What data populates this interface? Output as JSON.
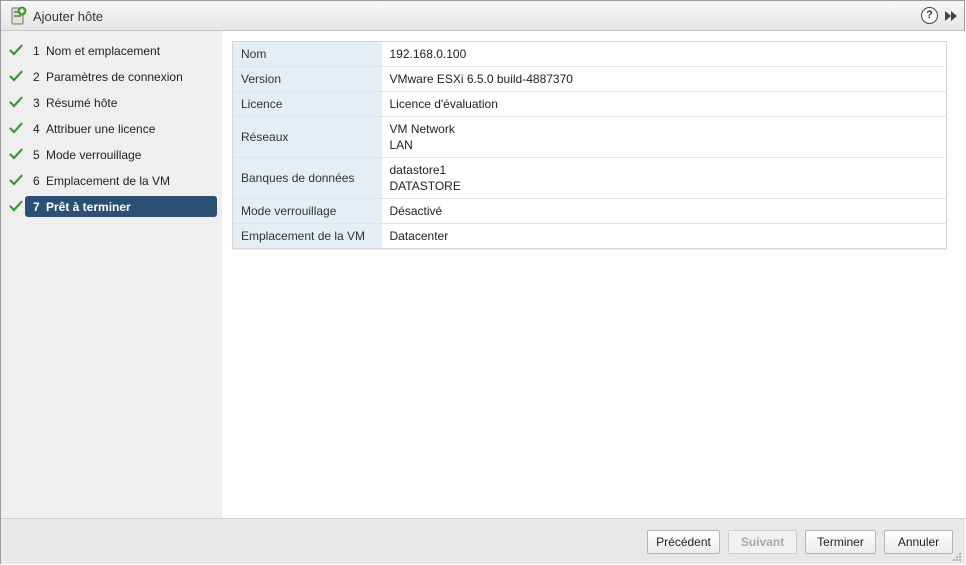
{
  "window": {
    "title": "Ajouter hôte",
    "help_label": "?"
  },
  "steps": [
    {
      "num": "1",
      "label": "Nom et emplacement",
      "completed": true,
      "active": false
    },
    {
      "num": "2",
      "label": "Paramètres de connexion",
      "completed": true,
      "active": false
    },
    {
      "num": "3",
      "label": "Résumé hôte",
      "completed": true,
      "active": false
    },
    {
      "num": "4",
      "label": "Attribuer une licence",
      "completed": true,
      "active": false
    },
    {
      "num": "5",
      "label": "Mode verrouillage",
      "completed": true,
      "active": false
    },
    {
      "num": "6",
      "label": "Emplacement de la VM",
      "completed": true,
      "active": false
    },
    {
      "num": "7",
      "label": "Prêt à terminer",
      "completed": true,
      "active": true
    }
  ],
  "summary": [
    {
      "key": "Nom",
      "values": [
        "192.168.0.100"
      ]
    },
    {
      "key": "Version",
      "values": [
        "VMware ESXi 6.5.0 build-4887370"
      ]
    },
    {
      "key": "Licence",
      "values": [
        "Licence d'évaluation"
      ]
    },
    {
      "key": "Réseaux",
      "values": [
        "VM Network",
        "LAN"
      ]
    },
    {
      "key": "Banques de données",
      "values": [
        "datastore1",
        "DATASTORE"
      ]
    },
    {
      "key": "Mode verrouillage",
      "values": [
        "Désactivé"
      ]
    },
    {
      "key": "Emplacement de la VM",
      "values": [
        "Datacenter"
      ]
    }
  ],
  "footer": {
    "back_label": "Précédent",
    "next_label": "Suivant",
    "finish_label": "Terminer",
    "cancel_label": "Annuler"
  },
  "colors": {
    "active_step": "#2c4f74",
    "check": "#3a9a3a",
    "key_cell": "#e6eef5"
  }
}
